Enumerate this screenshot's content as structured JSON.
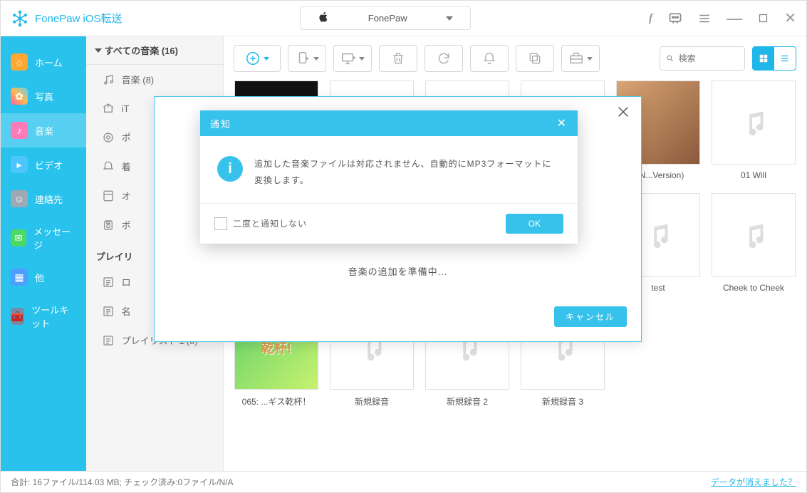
{
  "header": {
    "app_title": "FonePaw iOS転送",
    "device_name": "FonePaw"
  },
  "nav": {
    "items": [
      {
        "label": "ホーム"
      },
      {
        "label": "写真"
      },
      {
        "label": "音楽"
      },
      {
        "label": "ビデオ"
      },
      {
        "label": "連絡先"
      },
      {
        "label": "メッセージ"
      },
      {
        "label": "他"
      },
      {
        "label": "ツールキット"
      }
    ]
  },
  "sidebar": {
    "header": "すべての音楽 (16)",
    "items": [
      {
        "label": "音楽  (8)"
      },
      {
        "label": "iT"
      },
      {
        "label": "ポ"
      },
      {
        "label": "着"
      },
      {
        "label": "オ"
      },
      {
        "label": "ボ"
      }
    ],
    "section2_label": "プレイリ",
    "section2_items": [
      {
        "label": "ロ"
      },
      {
        "label": "名"
      },
      {
        "label": "プレイリスト１(0)"
      }
    ]
  },
  "toolbar": {
    "search_placeholder": "検索"
  },
  "grid": {
    "items": [
      {
        "title": "",
        "thumb": "black"
      },
      {
        "title": "",
        "thumb": "note"
      },
      {
        "title": "",
        "thumb": "note"
      },
      {
        "title": "",
        "thumb": "note"
      },
      {
        "title": "e N...Version)",
        "thumb": "photo"
      },
      {
        "title": "01 Will",
        "thumb": "note"
      },
      {
        "title": "",
        "thumb": "note"
      },
      {
        "title": "",
        "thumb": "note"
      },
      {
        "title": "",
        "thumb": "note"
      },
      {
        "title": "",
        "thumb": "note"
      },
      {
        "title": " test",
        "thumb": "note"
      },
      {
        "title": "Cheek to Cheek",
        "thumb": "note"
      },
      {
        "title": "065: ...ギス乾杯！",
        "thumb": "green"
      },
      {
        "title": "新規録音",
        "thumb": "note"
      },
      {
        "title": "新規録音 2",
        "thumb": "note"
      },
      {
        "title": "新規録音 3",
        "thumb": "note"
      }
    ]
  },
  "overlay": {
    "text": "音楽の追加を準備中...",
    "cancel": "キャンセル"
  },
  "dialog": {
    "title": "通知",
    "message": "追加した音楽ファイルは対応されません、自動的にMP3フォーマットに変換します。",
    "checkbox": "二度と通知しない",
    "ok": "OK"
  },
  "status": {
    "text": "合計: 16ファイル/114.03 MB; チェック済み:0ファイル/N/A",
    "link": "データが消えました？"
  }
}
